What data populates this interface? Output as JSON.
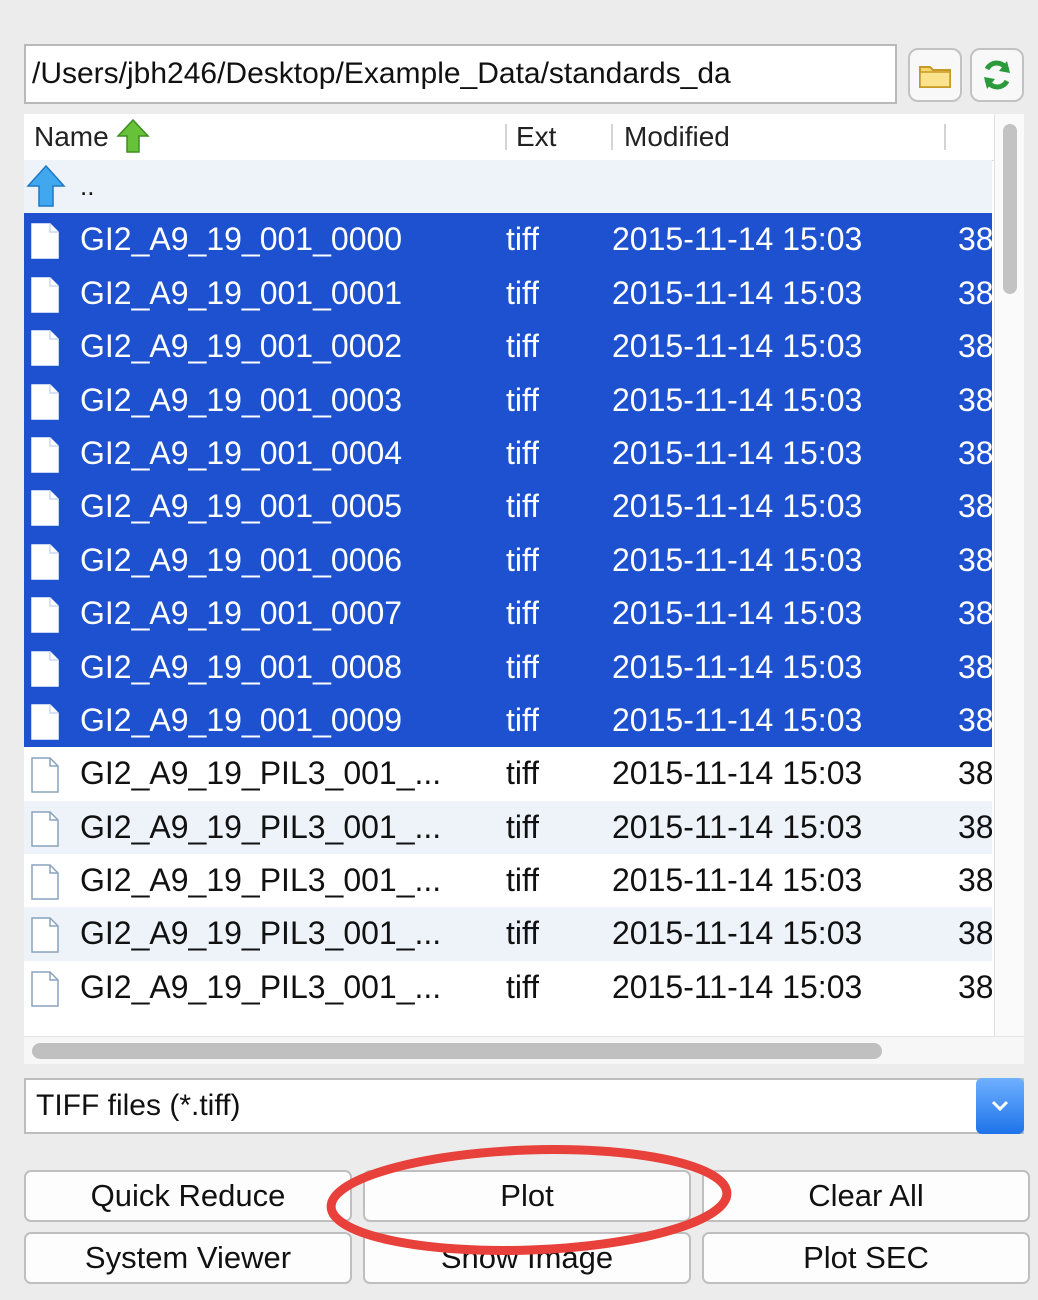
{
  "path_field": {
    "value": "/Users/jbh246/Desktop/Example_Data/standards_da"
  },
  "toolbar": {
    "folder_icon": "folder-icon",
    "refresh_icon": "refresh-icon"
  },
  "table": {
    "columns": {
      "name": "Name",
      "ext": "Ext",
      "modified": "Modified"
    },
    "parent_row": {
      "label": ".."
    },
    "rows": [
      {
        "name": "GI2_A9_19_001_0000",
        "ext": "tiff",
        "modified": "2015-11-14 15:03",
        "size": "38",
        "selected": true
      },
      {
        "name": "GI2_A9_19_001_0001",
        "ext": "tiff",
        "modified": "2015-11-14 15:03",
        "size": "38",
        "selected": true
      },
      {
        "name": "GI2_A9_19_001_0002",
        "ext": "tiff",
        "modified": "2015-11-14 15:03",
        "size": "38",
        "selected": true
      },
      {
        "name": "GI2_A9_19_001_0003",
        "ext": "tiff",
        "modified": "2015-11-14 15:03",
        "size": "38",
        "selected": true
      },
      {
        "name": "GI2_A9_19_001_0004",
        "ext": "tiff",
        "modified": "2015-11-14 15:03",
        "size": "38",
        "selected": true
      },
      {
        "name": "GI2_A9_19_001_0005",
        "ext": "tiff",
        "modified": "2015-11-14 15:03",
        "size": "38",
        "selected": true
      },
      {
        "name": "GI2_A9_19_001_0006",
        "ext": "tiff",
        "modified": "2015-11-14 15:03",
        "size": "38",
        "selected": true
      },
      {
        "name": "GI2_A9_19_001_0007",
        "ext": "tiff",
        "modified": "2015-11-14 15:03",
        "size": "38",
        "selected": true
      },
      {
        "name": "GI2_A9_19_001_0008",
        "ext": "tiff",
        "modified": "2015-11-14 15:03",
        "size": "38",
        "selected": true
      },
      {
        "name": "GI2_A9_19_001_0009",
        "ext": "tiff",
        "modified": "2015-11-14 15:03",
        "size": "38",
        "selected": true
      },
      {
        "name": "GI2_A9_19_PIL3_001_...",
        "ext": "tiff",
        "modified": "2015-11-14 15:03",
        "size": "38",
        "selected": false
      },
      {
        "name": "GI2_A9_19_PIL3_001_...",
        "ext": "tiff",
        "modified": "2015-11-14 15:03",
        "size": "38",
        "selected": false
      },
      {
        "name": "GI2_A9_19_PIL3_001_...",
        "ext": "tiff",
        "modified": "2015-11-14 15:03",
        "size": "38",
        "selected": false
      },
      {
        "name": "GI2_A9_19_PIL3_001_...",
        "ext": "tiff",
        "modified": "2015-11-14 15:03",
        "size": "38",
        "selected": false
      },
      {
        "name": "GI2_A9_19_PIL3_001_...",
        "ext": "tiff",
        "modified": "2015-11-14 15:03",
        "size": "38",
        "selected": false
      }
    ]
  },
  "filter": {
    "selected": "TIFF files (*.tiff)"
  },
  "buttons": {
    "quick_reduce": "Quick Reduce",
    "plot": "Plot",
    "clear_all": "Clear All",
    "system_viewer": "System Viewer",
    "show_image": "Show Image",
    "plot_sec": "Plot SEC"
  },
  "colors": {
    "selection": "#1d51d0",
    "annotation": "#e8403a"
  }
}
